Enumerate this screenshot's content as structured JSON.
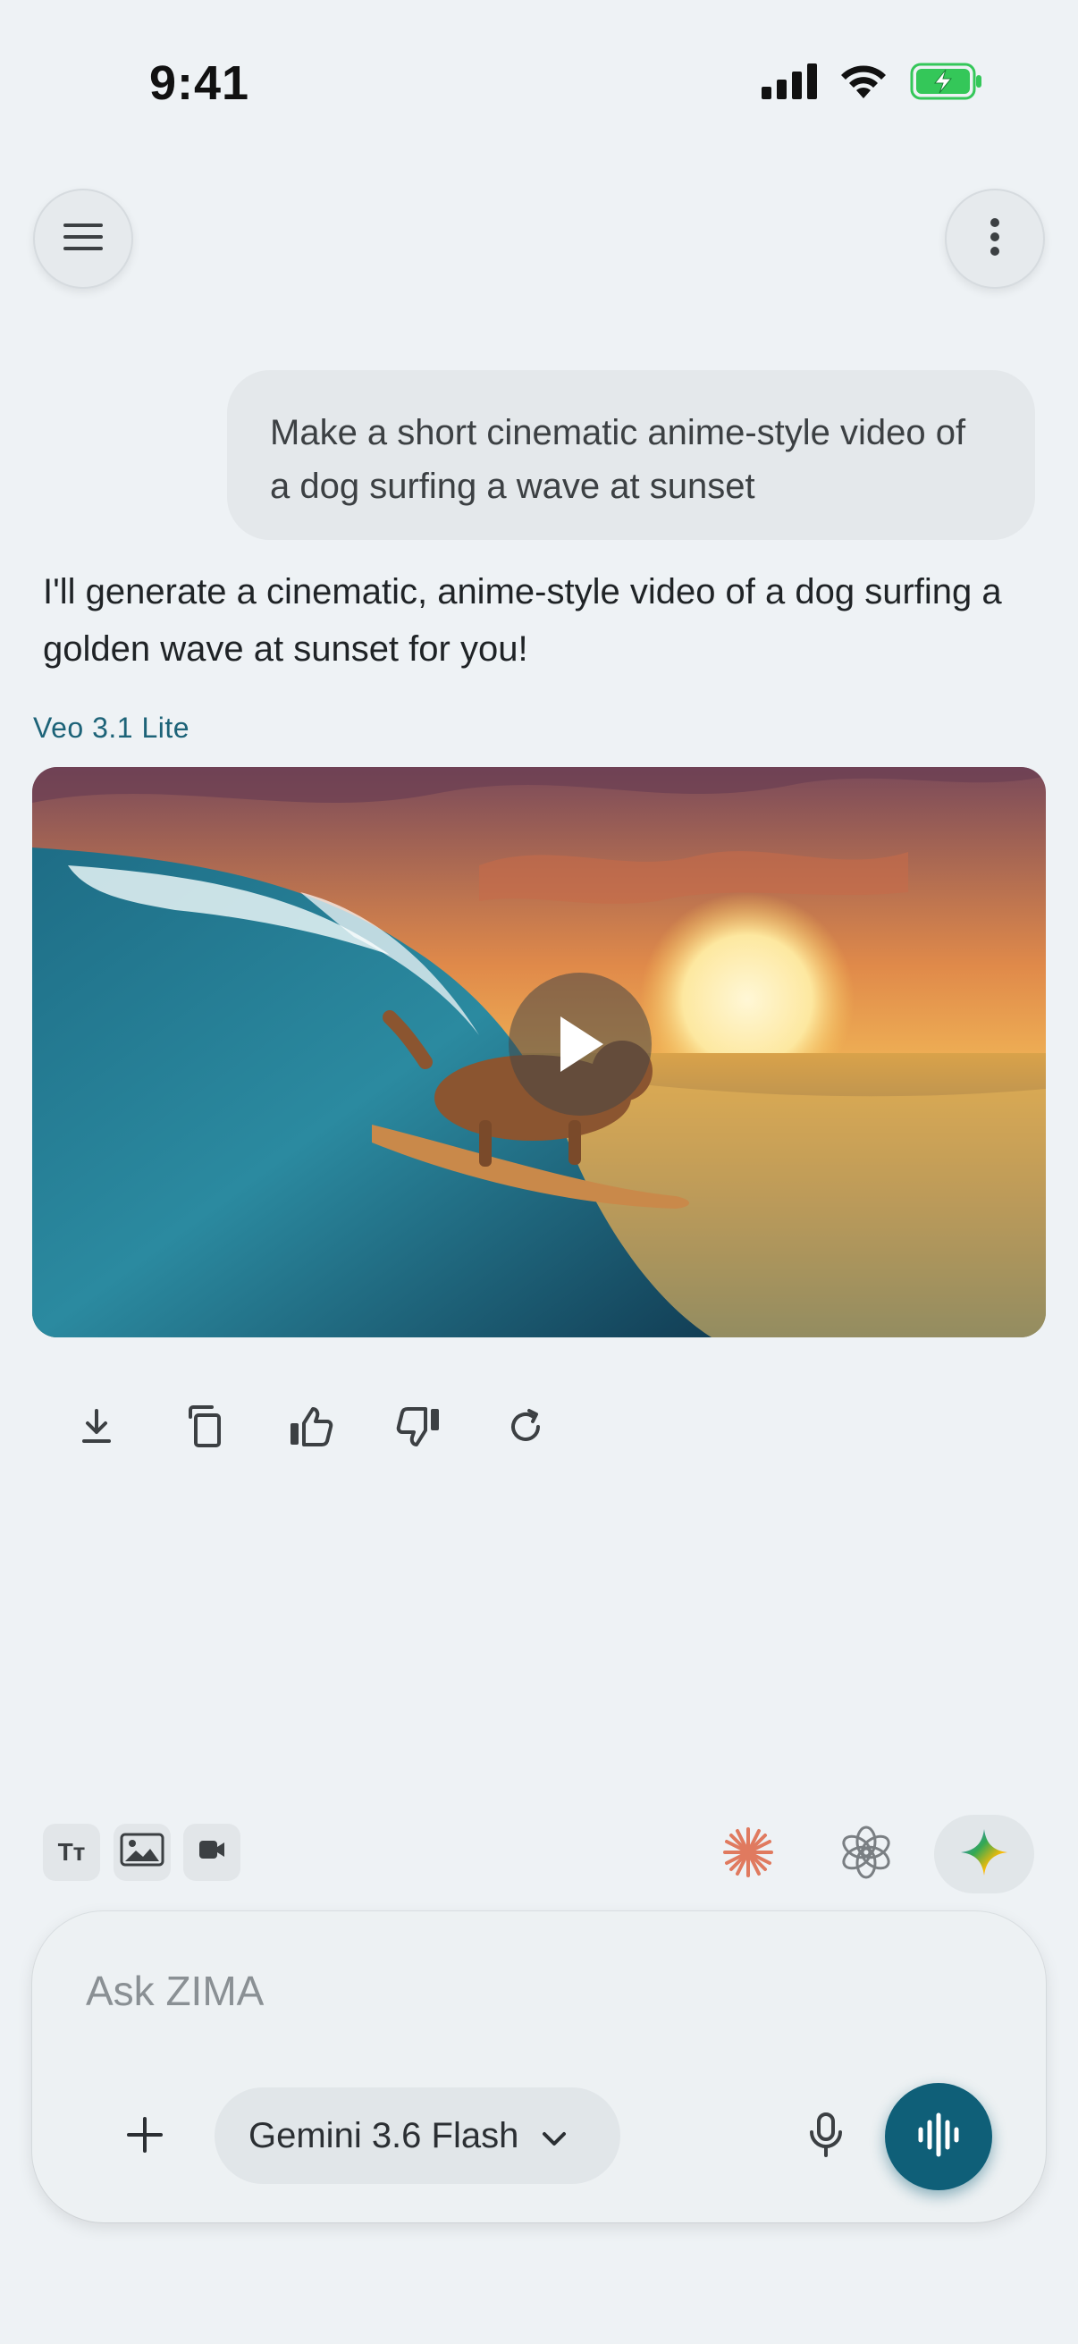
{
  "status_bar": {
    "time": "9:41"
  },
  "icons": {
    "menu": "hamburger-menu-icon",
    "more": "vertical-dots-icon",
    "signal": "cellular-signal-icon",
    "wifi": "wifi-icon",
    "battery": "battery-charging-icon"
  },
  "chat": {
    "user_message": "Make a short cinematic anime-style video of a dog surfing a wave at sunset",
    "assistant_message": "I'll generate a cinematic, anime-style video of a dog surfing a golden wave at sunset for you!",
    "model_label": "Veo 3.1 Lite"
  },
  "actions": [
    "download",
    "copy",
    "thumbs-up",
    "thumbs-down",
    "regenerate"
  ],
  "mode_chips": {
    "text_label": "Tт"
  },
  "composer": {
    "placeholder": "Ask ZIMA",
    "value": "",
    "model_selected": "Gemini 3.6 Flash"
  },
  "colors": {
    "accent": "#0f5f78",
    "model_label": "#1d6378",
    "background": "#eef2f5",
    "battery_green": "#34c759"
  }
}
